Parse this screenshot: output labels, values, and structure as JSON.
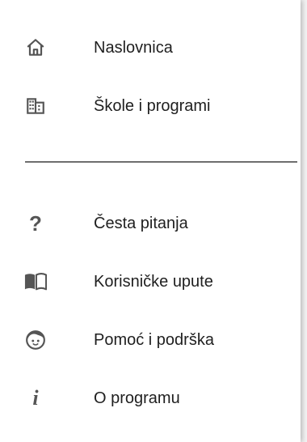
{
  "nav": {
    "primary": [
      {
        "label": "Naslovnica",
        "icon": "home-icon"
      },
      {
        "label": "Škole i programi",
        "icon": "building-icon"
      }
    ],
    "secondary": [
      {
        "label": "Česta pitanja",
        "icon": "question-mark-icon"
      },
      {
        "label": "Korisničke upute",
        "icon": "book-icon"
      },
      {
        "label": "Pomoć i podrška",
        "icon": "face-icon"
      },
      {
        "label": "O programu",
        "icon": "info-icon"
      }
    ]
  },
  "colors": {
    "icon": "#555555",
    "text": "#1f1f1f",
    "divider": "#6e6e6e",
    "background": "#ffffff"
  }
}
